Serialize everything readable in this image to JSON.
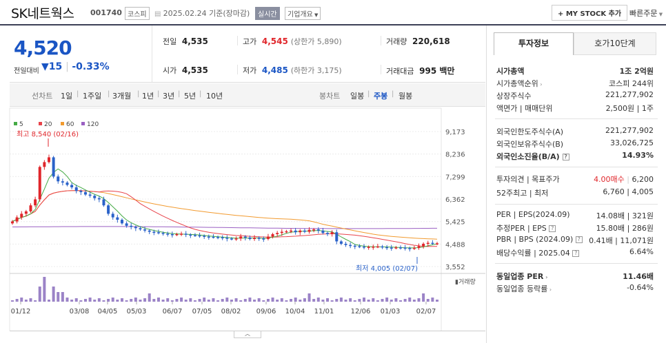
{
  "header": {
    "name": "SK네트웍스",
    "code": "001740",
    "market": "코스피",
    "date_line": "2025.02.24 기준(장마감)",
    "realtime": "실시간",
    "company_info": "기업개요",
    "mystock": "+ MY STOCK 추가",
    "quick_order": "빠른주문"
  },
  "quote": {
    "price": "4,520",
    "change_label": "전일대비",
    "change": "15",
    "change_pct": "-0.33%",
    "prev_label": "전일",
    "prev": "4,535",
    "open_label": "시가",
    "open": "4,535",
    "high_label": "고가",
    "high": "4,545",
    "upper_limit": "(상한가 5,890)",
    "low_label": "저가",
    "low": "4,485",
    "lower_limit": "(하한가 3,175)",
    "volume_label": "거래량",
    "volume": "220,618",
    "amount_label": "거래대금",
    "amount": "995 백만"
  },
  "range_bar": {
    "line_chart_label": "선차트",
    "line_ranges": [
      "1일",
      "1주일",
      "3개월",
      "1년",
      "3년",
      "5년",
      "10년"
    ],
    "candle_label": "봉차트",
    "candle_ranges": [
      "일봉",
      "주봉",
      "월봉"
    ],
    "selected_candle": "주봉"
  },
  "right_panel": {
    "tabs": [
      "투자정보",
      "호가10단계"
    ],
    "rows": [
      {
        "label": "시가총액",
        "value": "1조 2억원"
      },
      {
        "label": "시가총액순위",
        "value": "코스피 244위"
      },
      {
        "label": "상장주식수",
        "value": "221,277,902"
      },
      {
        "label": "액면가 | 매매단위",
        "value": "2,500원 | 1주"
      },
      {
        "label": "외국인한도주식수(A)",
        "value": "221,277,902"
      },
      {
        "label": "외국인보유주식수(B)",
        "value": "33,026,725"
      },
      {
        "label": "외국인소진율(B/A)",
        "value": "14.93%"
      },
      {
        "label": "투자의견 | 목표주가",
        "value1": "4.00매수",
        "value2": "6,200"
      },
      {
        "label": "52주최고 | 최저",
        "value": "6,760 | 4,005"
      },
      {
        "label": "PER | EPS(2024.09)",
        "value": "14.08배 | 321원"
      },
      {
        "label": "추정PER | EPS",
        "value": "15.80배 | 286원"
      },
      {
        "label": "PBR | BPS (2024.09)",
        "value": "0.41배 | 11,071원"
      },
      {
        "label": "배당수익률 | 2025.04",
        "value": "6.64%"
      },
      {
        "label": "동일업종 PER",
        "value": "11.46배"
      },
      {
        "label": "동일업종 등락률",
        "value": "-0.64%"
      }
    ]
  },
  "chart_data": {
    "type": "candlestick",
    "title": "",
    "legend": [
      "5",
      "20",
      "60",
      "120"
    ],
    "legend_colors": [
      "#44aa44",
      "#e8434a",
      "#f29a2e",
      "#9a5fc2"
    ],
    "y_ticks": [
      9173,
      8236,
      7299,
      6362,
      5425,
      4488,
      3552
    ],
    "ylim": [
      3552,
      9173
    ],
    "x_labels": [
      "01/12",
      "03/08",
      "04/05",
      "05/03",
      "06/07",
      "07/05",
      "08/02",
      "09/06",
      "10/04",
      "11/01",
      "12/06",
      "01/03",
      "02/07"
    ],
    "high_note": "최고 8,540 (02/16)",
    "low_note": "최저 4,005 (02/07)",
    "volume_label": "거래량",
    "closes": [
      5430,
      5600,
      5750,
      5850,
      6100,
      6350,
      7700,
      7900,
      8100,
      7300,
      7100,
      7050,
      6950,
      6850,
      6700,
      6650,
      6550,
      6500,
      6400,
      6350,
      6100,
      5750,
      5600,
      5500,
      5350,
      5250,
      5200,
      5150,
      5100,
      5050,
      5000,
      4980,
      4950,
      4920,
      4900,
      4880,
      4900,
      4920,
      4880,
      4860,
      4850,
      4830,
      4800,
      4790,
      4780,
      4770,
      4750,
      4720,
      4700,
      4720,
      4800,
      4760,
      4700,
      4750,
      4720,
      4700,
      4800,
      4900,
      4950,
      5000,
      5020,
      5050,
      4980,
      5050,
      5000,
      5080,
      5100,
      5050,
      4950,
      4900,
      4980,
      4600,
      4500,
      4450,
      4420,
      4400,
      4380,
      4350,
      4370,
      4380,
      4390,
      4360,
      4340,
      4330,
      4350,
      4340,
      4320,
      4300,
      4330,
      4400,
      4500,
      4540,
      4520,
      4520
    ],
    "moving_average_120_end": 5150
  }
}
